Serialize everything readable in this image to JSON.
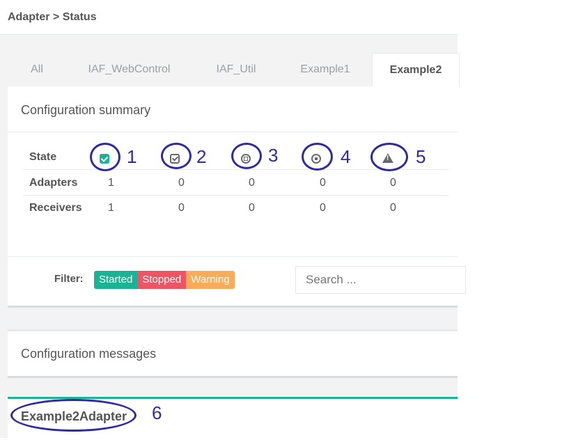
{
  "breadcrumb": "Adapter > Status",
  "tabs": [
    {
      "label": "All",
      "active": false
    },
    {
      "label": "IAF_WebControl",
      "active": false
    },
    {
      "label": "IAF_Util",
      "active": false
    },
    {
      "label": "Example1",
      "active": false
    },
    {
      "label": "Example2",
      "active": true
    }
  ],
  "summary": {
    "title": "Configuration summary",
    "state_label": "State",
    "state_icons": [
      "started-icon",
      "stopped-check-icon",
      "stop-circle-icon",
      "dot-circle-icon",
      "warning-icon"
    ],
    "rows": [
      {
        "label": "Adapters",
        "values": [
          "1",
          "0",
          "0",
          "0",
          "0"
        ]
      },
      {
        "label": "Receivers",
        "values": [
          "1",
          "0",
          "0",
          "0",
          "0"
        ]
      }
    ]
  },
  "filter": {
    "label": "Filter:",
    "buttons": [
      "Started",
      "Stopped",
      "Warning"
    ],
    "search_placeholder": "Search ..."
  },
  "messages": {
    "title": "Configuration messages"
  },
  "adapter": {
    "name": "Example2Adapter"
  },
  "annotations": [
    "1",
    "2",
    "3",
    "4",
    "5",
    "6"
  ],
  "colors": {
    "accent": "#1ab394",
    "danger": "#ed5565",
    "warning": "#f8ac59",
    "annotation": "#2e2aa1"
  }
}
